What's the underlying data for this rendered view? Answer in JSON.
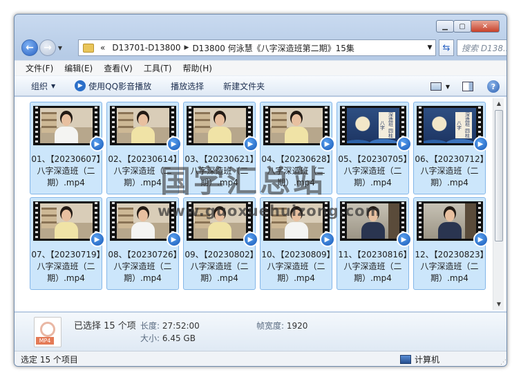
{
  "window": {
    "caption_buttons": [
      "minimize",
      "maximize",
      "close"
    ]
  },
  "nav": {
    "back_icon": "back-arrow-icon",
    "forward_icon": "forward-arrow-icon"
  },
  "address": {
    "overflow": "«",
    "segments": [
      "D13701-D13800",
      "D13800 何泳慧《八字深造班第二期》15集"
    ],
    "search_placeholder": "搜索 D138...",
    "search_icon": "⌕"
  },
  "menu": [
    "文件(F)",
    "编辑(E)",
    "查看(V)",
    "工具(T)",
    "帮助(H)"
  ],
  "toolbar": {
    "organize": "组织",
    "play_qq": "使用QQ影音播放",
    "play_selection": "播放选择",
    "new_folder": "新建文件夹"
  },
  "files": [
    {
      "name": "01、【20230607】八字深造班（二期）.mp4",
      "scene": "room",
      "person": "white"
    },
    {
      "name": "02、【20230614】八字深造班（二期）.mp4",
      "scene": "room",
      "person": "yellow"
    },
    {
      "name": "03、【20230621】八字深造班（二期）.mp4",
      "scene": "room",
      "person": "yellow"
    },
    {
      "name": "04、【20230628】八字深造班（二期）.mp4",
      "scene": "room",
      "person": "yellow"
    },
    {
      "name": "05、【20230705】八字深造班（二期）.mp4",
      "scene": "blue",
      "caption": "深造班 四柱八字"
    },
    {
      "name": "06、【20230712】八字深造班（二期）.mp4",
      "scene": "blue",
      "caption": "深造班 四柱八字"
    },
    {
      "name": "07、【20230719】八字深造班（二期）.mp4",
      "scene": "room",
      "person": "yellow"
    },
    {
      "name": "08、【20230726】八字深造班（二期）.mp4",
      "scene": "room",
      "person": "white"
    },
    {
      "name": "09、【20230802】八字深造班（二期）.mp4",
      "scene": "room",
      "person": "yellow"
    },
    {
      "name": "10、【20230809】八字深造班（二期）.mp4",
      "scene": "room",
      "person": "white"
    },
    {
      "name": "11、【20230816】八字深造班（二期）.mp4",
      "scene": "dark",
      "person": "dark"
    },
    {
      "name": "12、【20230823】八字深造班（二期）.mp4",
      "scene": "dark",
      "person": "dark"
    }
  ],
  "details": {
    "selected": "已选择 15 个项",
    "length_label": "长度:",
    "length_value": "27:52:00",
    "size_label": "大小:",
    "size_value": "6.45 GB",
    "width_label": "帧宽度:",
    "width_value": "1920",
    "file_type": "MP4"
  },
  "status": {
    "left": "选定 15 个项目",
    "right": "计算机"
  },
  "watermark": {
    "big": "国学汇总站",
    "small": "www.guoxuehuizong.com"
  },
  "colors": {
    "selection_fill": "#cce6fb",
    "selection_border": "#84b6e8",
    "qq_blue": "#1759b7"
  }
}
